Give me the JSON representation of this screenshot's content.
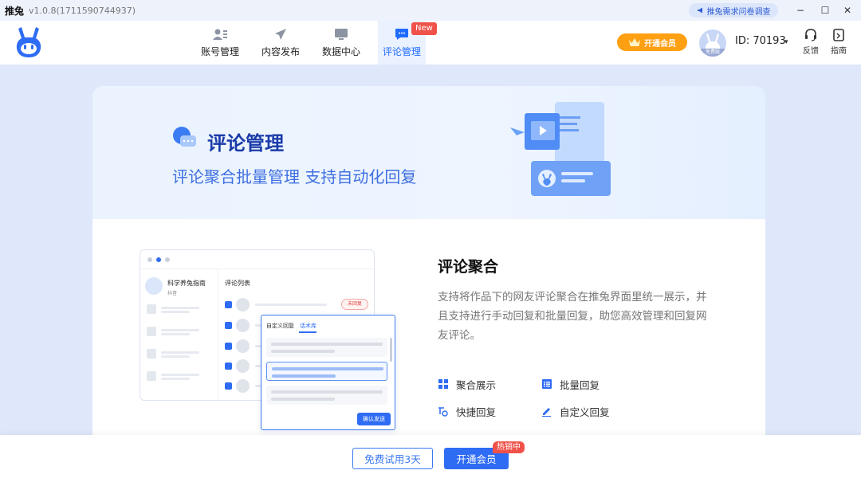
{
  "titlebar": {
    "app_name": "推兔",
    "version": "v1.0.8(1711590744937)",
    "survey_label": "推兔需求问卷调查",
    "minimize": "−",
    "maximize": "☐",
    "close": "✕"
  },
  "nav": {
    "items": [
      {
        "label": "账号管理",
        "icon": "account-icon"
      },
      {
        "label": "内容发布",
        "icon": "paper-plane-icon"
      },
      {
        "label": "数据中心",
        "icon": "monitor-icon"
      },
      {
        "label": "评论管理",
        "icon": "comment-icon",
        "active": true
      }
    ],
    "new_badge": "New"
  },
  "header": {
    "vip_label": "开通会员",
    "avatar_tag": "免费版",
    "user_id": "ID: 70193",
    "id_caret": "▾",
    "feedback_label": "反馈",
    "guide_label": "指南"
  },
  "hero": {
    "title": "评论管理",
    "subtitle": "评论聚合批量管理 支持自动化回复"
  },
  "mockup": {
    "account_name": "科学养兔指南",
    "platform": "抖音",
    "list_title": "评论列表",
    "unreplied_tag": "未回复",
    "popup_tab_custom": "自定义回复",
    "popup_tab_library": "话术库",
    "popup_send": "确认发送"
  },
  "feature": {
    "title": "评论聚合",
    "description": "支持将作品下的网友评论聚合在推兔界面里统一展示，并且支持进行手动回复和批量回复，助您高效管理和回复网友评论。",
    "items": [
      {
        "label": "聚合展示",
        "icon": "grid-icon"
      },
      {
        "label": "批量回复",
        "icon": "list-icon"
      },
      {
        "label": "快捷回复",
        "icon": "quick-reply-icon"
      },
      {
        "label": "自定义回复",
        "icon": "pen-icon"
      }
    ]
  },
  "bottom": {
    "trial_label": "免费试用3天",
    "join_label": "开通会员",
    "hot_badge": "热销中"
  },
  "colors": {
    "primary": "#2f6cf4",
    "vip_orange": "#ff9f12",
    "badge_red": "#f0524a",
    "hero_title": "#1a3ba8"
  }
}
